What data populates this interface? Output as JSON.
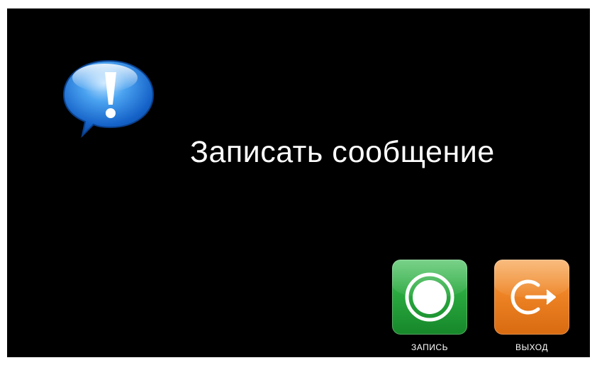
{
  "screen": {
    "title": "Записать сообщение",
    "icon": "speech-bubble-exclamation-icon"
  },
  "actions": {
    "record": {
      "label": "ЗАПИСЬ",
      "icon": "record-circle-icon",
      "color": "#2aa93f"
    },
    "exit": {
      "label": "ВЫХОД",
      "icon": "exit-arrow-icon",
      "color": "#ee8425"
    }
  },
  "colors": {
    "background": "#000000",
    "text": "#ffffff",
    "bubble": "#2f7fe0"
  }
}
